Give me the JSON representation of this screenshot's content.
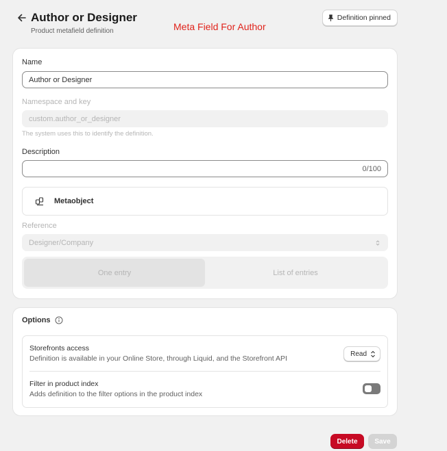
{
  "header": {
    "title": "Author or Designer",
    "subtitle": "Product metafield definition",
    "annotation": "Meta Field For Author",
    "pin_button": "Definition pinned"
  },
  "form": {
    "name_label": "Name",
    "name_value": "Author or Designer",
    "namespace_label": "Namespace and key",
    "namespace_value": "custom.author_or_designer",
    "namespace_help": "The system uses this to identify the definition.",
    "description_label": "Description",
    "description_value": "",
    "description_counter": "0/100",
    "type_name": "Metaobject",
    "reference_label": "Reference",
    "reference_value": "Designer/Company",
    "segments": [
      "One entry",
      "List of entries"
    ],
    "selected_segment": "One entry"
  },
  "options": {
    "title": "Options",
    "rows": [
      {
        "name": "Storefronts access",
        "description": "Definition is available in your Online Store, through Liquid, and the Storefront API",
        "control": "Read"
      },
      {
        "name": "Filter in product index",
        "description": "Adds definition to the filter options in the product index",
        "toggle_on": false
      }
    ]
  },
  "footer": {
    "delete_label": "Delete",
    "save_label": "Save"
  },
  "icons": {
    "back": "arrow-left-icon",
    "pin": "pin-icon",
    "type": "metaobject-icon",
    "info": "info-icon",
    "select": "chevron-up-down-icon"
  },
  "colors": {
    "annotation": "#e0231b",
    "delete": "#c70a24",
    "background": "#f1f1f1"
  }
}
